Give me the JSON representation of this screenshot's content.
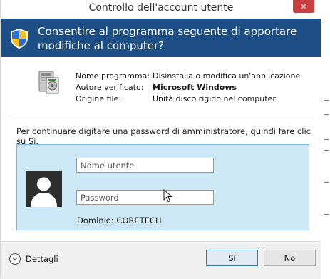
{
  "window": {
    "title": "Controllo dell'account utente",
    "close_glyph": "✕"
  },
  "banner": {
    "icon": "uac-shield-icon",
    "line1": "Consentire al programma seguente di apportare",
    "line2": "modifiche al computer?"
  },
  "info": {
    "icon": "program-icon",
    "rows": [
      {
        "label": "Nome programma:",
        "value": "Disinstalla o modifica un'applicazione"
      },
      {
        "label": "Autore verificato:",
        "value": "Microsoft Windows"
      },
      {
        "label": "Origine file:",
        "value": "Unità disco rigido nel computer"
      }
    ]
  },
  "instruction": "Per continuare digitare una password di amministratore, quindi fare clic su Sì.",
  "credentials": {
    "avatar_icon": "user-avatar-icon",
    "username_placeholder": "Nome utente",
    "username_value": "",
    "password_placeholder": "Password",
    "password_value": "",
    "domain": "Dominio: CORETECH"
  },
  "footer": {
    "details_label": "Dettagli",
    "details_icon": "chevron-down-circle-icon",
    "yes_label": "Sì",
    "no_label": "No"
  },
  "colors": {
    "banner_bg": "#1d4f86",
    "panel_bg": "#cce8f7",
    "panel_border": "#7eb4de",
    "close_bg": "#c94040"
  }
}
